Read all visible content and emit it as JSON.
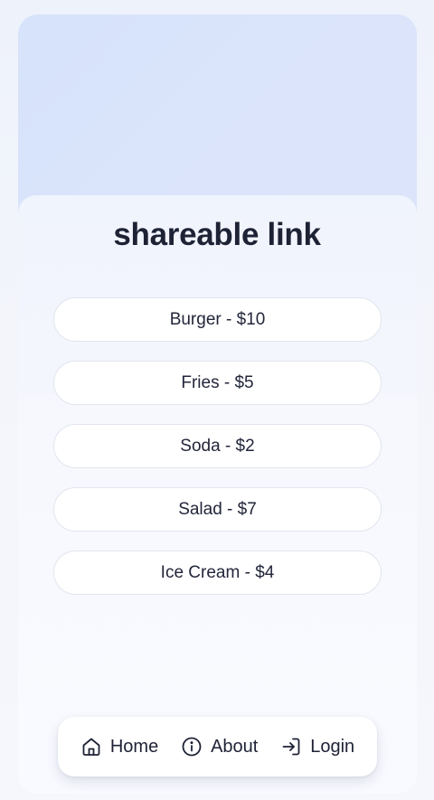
{
  "page": {
    "title": "shareable link"
  },
  "menu": {
    "items": [
      {
        "label": "Burger - $10"
      },
      {
        "label": "Fries - $5"
      },
      {
        "label": "Soda - $2"
      },
      {
        "label": "Salad - $7"
      },
      {
        "label": "Ice Cream - $4"
      }
    ]
  },
  "nav": {
    "items": [
      {
        "label": "Home",
        "icon": "home-icon"
      },
      {
        "label": "About",
        "icon": "info-icon"
      },
      {
        "label": "Login",
        "icon": "login-icon"
      }
    ]
  },
  "colors": {
    "title_text": "#1e2235",
    "hero_gradient_start": "#d6e3fb",
    "hero_gradient_end": "#dde3fb",
    "item_background": "#ffffff"
  }
}
